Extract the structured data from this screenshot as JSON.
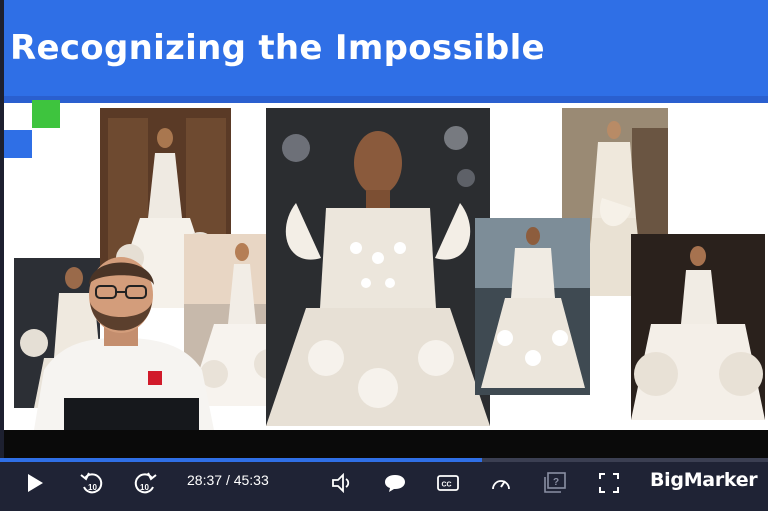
{
  "slide": {
    "title": "Recognizing the Impossible"
  },
  "player": {
    "current_time": "28:37",
    "separator": "/",
    "duration": "45:33",
    "progress": 0.628,
    "brand": "BigMarker"
  },
  "colors": {
    "title_bar": "#2f6fe6",
    "accent_green": "#3ec43e",
    "accent_blue": "#2f6fe6",
    "controls_bg": "#1f2335"
  },
  "icons": [
    "play-icon",
    "rewind-10-icon",
    "forward-10-icon",
    "volume-icon",
    "chat-icon",
    "closed-captions-icon",
    "speed-icon",
    "question-icon",
    "fullscreen-icon"
  ]
}
